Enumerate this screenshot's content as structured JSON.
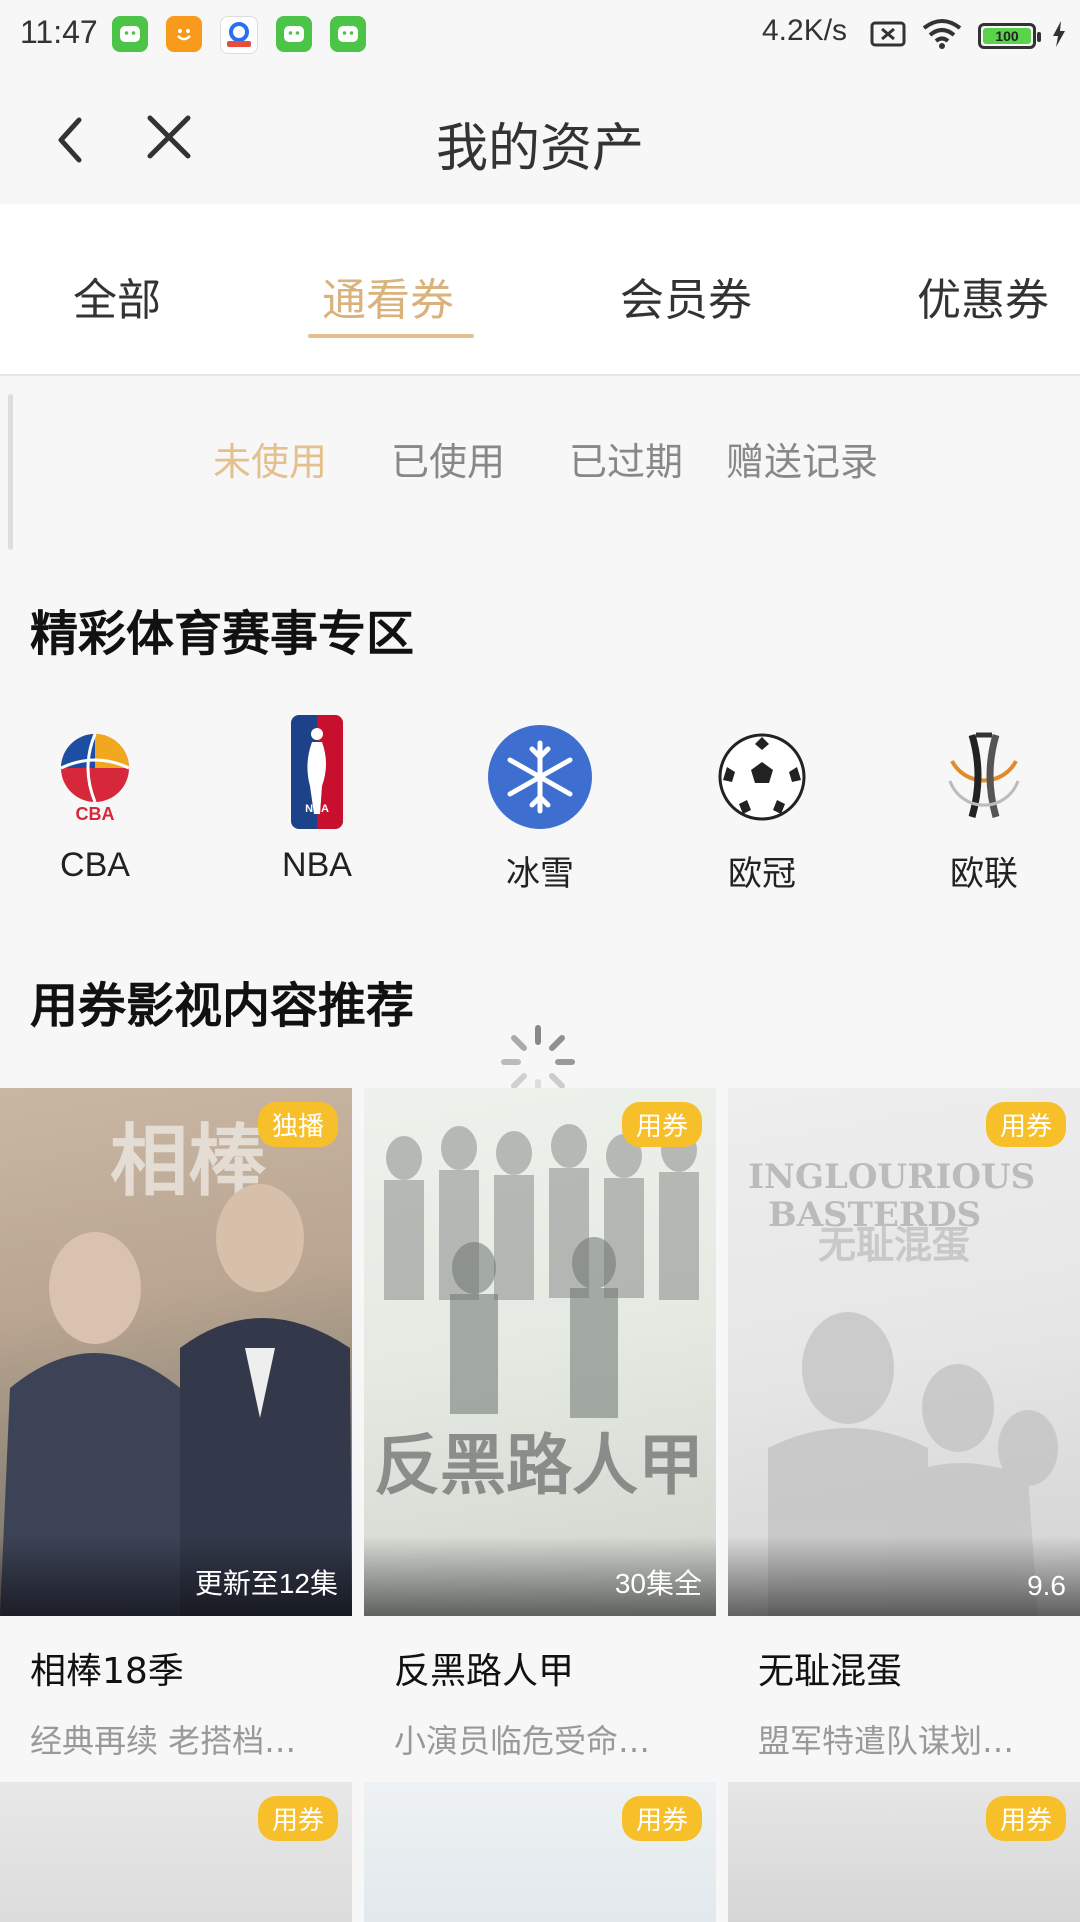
{
  "status_bar": {
    "time": "11:47",
    "net_speed": "4.2K/s",
    "battery": "100",
    "app_icons": [
      "wechat-like-icon",
      "face-icon",
      "browser-icon",
      "wechat-like-icon",
      "wechat-like-icon"
    ]
  },
  "nav": {
    "title": "我的资产"
  },
  "tabs": [
    {
      "label": "全部",
      "active": false
    },
    {
      "label": "通看券",
      "active": true
    },
    {
      "label": "会员券",
      "active": false
    },
    {
      "label": "优惠券",
      "active": false
    }
  ],
  "subtabs": [
    {
      "label": "未使用",
      "active": true
    },
    {
      "label": "已使用",
      "active": false
    },
    {
      "label": "已过期",
      "active": false
    },
    {
      "label": "赠送记录",
      "active": false
    }
  ],
  "sports_section": {
    "title": "精彩体育赛事专区",
    "items": [
      {
        "label": "CBA",
        "icon": "cba-logo-icon"
      },
      {
        "label": "NBA",
        "icon": "nba-logo-icon"
      },
      {
        "label": "冰雪",
        "icon": "snowflake-icon"
      },
      {
        "label": "欧冠",
        "icon": "soccer-ball-icon"
      },
      {
        "label": "欧联",
        "icon": "europa-league-icon"
      }
    ]
  },
  "recommend_section": {
    "title": "用券影视内容推荐",
    "cards": [
      {
        "badge": "独播",
        "corner": "更新至12集",
        "title": "相棒18季",
        "desc": "经典再续 老搭档…",
        "poster_text": "相棒"
      },
      {
        "badge": "用券",
        "corner": "30集全",
        "title": "反黑路人甲",
        "desc": "小演员临危受命…",
        "poster_text": "反黑路人甲"
      },
      {
        "badge": "用券",
        "corner": "9.6",
        "title": "无耻混蛋",
        "desc": "盟军特遣队谋划…",
        "poster_text": "INGLOURIOUS BASTERDS 无耻混蛋"
      }
    ],
    "row2_badges": [
      "用券",
      "用券",
      "用券"
    ]
  },
  "colors": {
    "accent": "#d9b27c",
    "badge": "#f7c02a",
    "bg": "#f7f7f7"
  }
}
